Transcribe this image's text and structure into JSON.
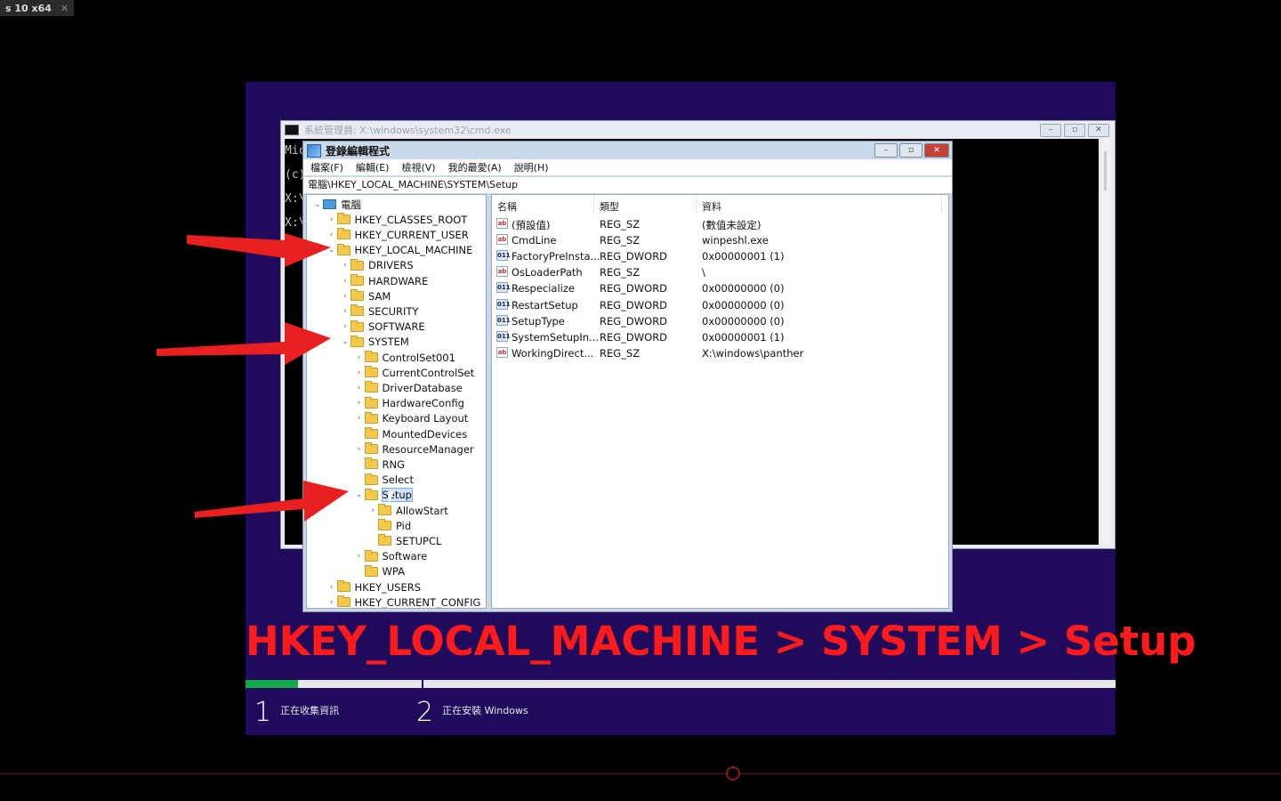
{
  "vm_tab": {
    "label": "s 10 x64",
    "close": "✕"
  },
  "cmd": {
    "title": "系統管理員: X:\\windows\\system32\\cmd.exe",
    "lines": [
      "Mic",
      "(c)",
      "",
      "X:\\",
      "",
      "X:\\"
    ]
  },
  "regedit": {
    "title": "登錄編輯程式",
    "menu": [
      "檔案(F)",
      "編輯(E)",
      "檢視(V)",
      "我的最愛(A)",
      "說明(H)"
    ],
    "address": "電腦\\HKEY_LOCAL_MACHINE\\SYSTEM\\Setup",
    "tree": [
      {
        "label": "電腦",
        "level": 0,
        "state": "expanded",
        "icon": "computer-icon"
      },
      {
        "label": "HKEY_CLASSES_ROOT",
        "level": 1,
        "state": "collapsed"
      },
      {
        "label": "HKEY_CURRENT_USER",
        "level": 1,
        "state": "collapsed"
      },
      {
        "label": "HKEY_LOCAL_MACHINE",
        "level": 1,
        "state": "expanded"
      },
      {
        "label": "DRIVERS",
        "level": 2,
        "state": "collapsed"
      },
      {
        "label": "HARDWARE",
        "level": 2,
        "state": "collapsed"
      },
      {
        "label": "SAM",
        "level": 2,
        "state": "collapsed"
      },
      {
        "label": "SECURITY",
        "level": 2,
        "state": "collapsed"
      },
      {
        "label": "SOFTWARE",
        "level": 2,
        "state": "collapsed"
      },
      {
        "label": "SYSTEM",
        "level": 2,
        "state": "expanded"
      },
      {
        "label": "ControlSet001",
        "level": 3,
        "state": "collapsed"
      },
      {
        "label": "CurrentControlSet",
        "level": 3,
        "state": "collapsed"
      },
      {
        "label": "DriverDatabase",
        "level": 3,
        "state": "collapsed"
      },
      {
        "label": "HardwareConfig",
        "level": 3,
        "state": "collapsed"
      },
      {
        "label": "Keyboard Layout",
        "level": 3,
        "state": "collapsed"
      },
      {
        "label": "MountedDevices",
        "level": 3,
        "state": "leaf"
      },
      {
        "label": "ResourceManager",
        "level": 3,
        "state": "collapsed"
      },
      {
        "label": "RNG",
        "level": 3,
        "state": "leaf"
      },
      {
        "label": "Select",
        "level": 3,
        "state": "leaf"
      },
      {
        "label": "Setup",
        "level": 3,
        "state": "expanded",
        "selected": true
      },
      {
        "label": "AllowStart",
        "level": 4,
        "state": "collapsed"
      },
      {
        "label": "Pid",
        "level": 4,
        "state": "leaf"
      },
      {
        "label": "SETUPCL",
        "level": 4,
        "state": "leaf"
      },
      {
        "label": "Software",
        "level": 3,
        "state": "collapsed"
      },
      {
        "label": "WPA",
        "level": 3,
        "state": "leaf"
      },
      {
        "label": "HKEY_USERS",
        "level": 1,
        "state": "collapsed"
      },
      {
        "label": "HKEY_CURRENT_CONFIG",
        "level": 1,
        "state": "collapsed"
      }
    ],
    "columns": [
      "名稱",
      "類型",
      "資料"
    ],
    "values": [
      {
        "icon": "ab",
        "name": "(預設值)",
        "type": "REG_SZ",
        "data": "(數值未設定)"
      },
      {
        "icon": "ab",
        "name": "CmdLine",
        "type": "REG_SZ",
        "data": "winpeshl.exe"
      },
      {
        "icon": "dw",
        "name": "FactoryPreInsta...",
        "type": "REG_DWORD",
        "data": "0x00000001 (1)"
      },
      {
        "icon": "ab",
        "name": "OsLoaderPath",
        "type": "REG_SZ",
        "data": "\\"
      },
      {
        "icon": "dw",
        "name": "Respecialize",
        "type": "REG_DWORD",
        "data": "0x00000000 (0)"
      },
      {
        "icon": "dw",
        "name": "RestartSetup",
        "type": "REG_DWORD",
        "data": "0x00000000 (0)"
      },
      {
        "icon": "dw",
        "name": "SetupType",
        "type": "REG_DWORD",
        "data": "0x00000000 (0)"
      },
      {
        "icon": "dw",
        "name": "SystemSetupIn...",
        "type": "REG_DWORD",
        "data": "0x00000001 (1)"
      },
      {
        "icon": "ab",
        "name": "WorkingDirect...",
        "type": "REG_SZ",
        "data": "X:\\windows\\panther"
      }
    ],
    "value_icon_text": {
      "ab": "ab",
      "dw": "011"
    }
  },
  "caption": "HKEY_LOCAL_MACHINE > SYSTEM > Setup",
  "setup_progress": {
    "fraction": 0.06
  },
  "steps": [
    {
      "num": "1",
      "label": "正在收集資訊"
    },
    {
      "num": "2",
      "label": "正在安裝 Windows"
    }
  ],
  "colors": {
    "accent_red": "#ff1b1b",
    "setup_bg": "#1f0a5c",
    "progress_green": "#12a84a"
  }
}
